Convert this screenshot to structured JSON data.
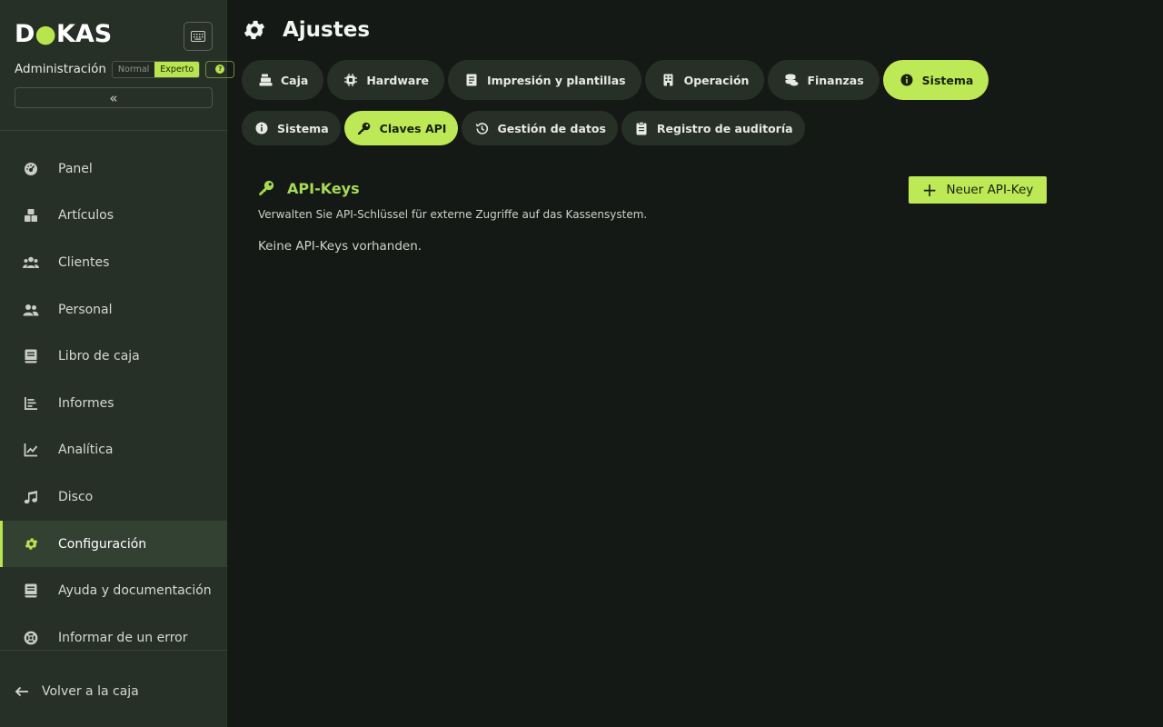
{
  "sidebar": {
    "logo": {
      "part1": "D",
      "part2": "KAS"
    },
    "admin_label": "Administración",
    "modes": {
      "normal": "Normal",
      "expert": "Experto"
    },
    "collapse_glyph": "«",
    "items": [
      {
        "label": "Panel",
        "icon": "dashboard-icon"
      },
      {
        "label": "Artículos",
        "icon": "boxes-icon"
      },
      {
        "label": "Clientes",
        "icon": "users-icon"
      },
      {
        "label": "Personal",
        "icon": "staff-icon"
      },
      {
        "label": "Libro de caja",
        "icon": "book-icon"
      },
      {
        "label": "Informes",
        "icon": "report-icon"
      },
      {
        "label": "Analítica",
        "icon": "chart-icon"
      },
      {
        "label": "Disco",
        "icon": "music-icon"
      },
      {
        "label": "Configuración",
        "icon": "gear-icon",
        "active": true
      },
      {
        "label": "Ayuda y documentación",
        "icon": "book-icon"
      },
      {
        "label": "Informar de un error",
        "icon": "lifebuoy-icon"
      }
    ],
    "back_label": "Volver a la caja"
  },
  "header": {
    "title": "Ajustes"
  },
  "primary_tabs": [
    {
      "label": "Caja",
      "icon": "register-icon"
    },
    {
      "label": "Hardware",
      "icon": "chip-icon"
    },
    {
      "label": "Impresión y plantillas",
      "icon": "document-icon"
    },
    {
      "label": "Operación",
      "icon": "building-icon"
    },
    {
      "label": "Finanzas",
      "icon": "coins-icon"
    },
    {
      "label": "Sistema",
      "icon": "info-icon",
      "active": true
    }
  ],
  "secondary_tabs": [
    {
      "label": "Sistema",
      "icon": "info-icon"
    },
    {
      "label": "Claves API",
      "icon": "key-icon",
      "active": true
    },
    {
      "label": "Gestión de datos",
      "icon": "history-icon"
    },
    {
      "label": "Registro de auditoría",
      "icon": "clipboard-icon"
    }
  ],
  "section": {
    "title": "API-Keys",
    "description": "Verwalten Sie API-Schlüssel für externe Zugriffe auf das Kassensystem.",
    "empty": "Keine API-Keys vorhanden.",
    "new_button": "Neuer API-Key",
    "new_button_glyph": "+"
  },
  "colors": {
    "accent": "#bce955",
    "accent_text": "#a6d957",
    "sidebar_bg": "#273027",
    "main_bg": "#151915"
  }
}
